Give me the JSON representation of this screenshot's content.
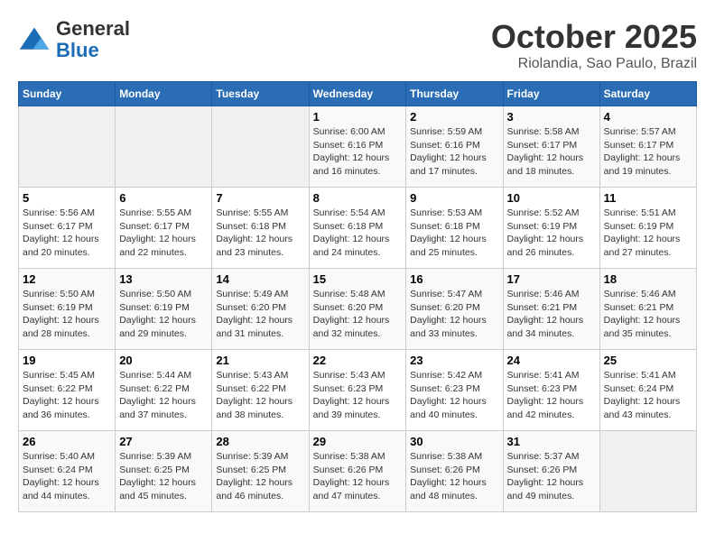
{
  "header": {
    "logo_line1": "General",
    "logo_line2": "Blue",
    "month": "October 2025",
    "location": "Riolandia, Sao Paulo, Brazil"
  },
  "weekdays": [
    "Sunday",
    "Monday",
    "Tuesday",
    "Wednesday",
    "Thursday",
    "Friday",
    "Saturday"
  ],
  "weeks": [
    [
      {
        "day": "",
        "info": ""
      },
      {
        "day": "",
        "info": ""
      },
      {
        "day": "",
        "info": ""
      },
      {
        "day": "1",
        "info": "Sunrise: 6:00 AM\nSunset: 6:16 PM\nDaylight: 12 hours\nand 16 minutes."
      },
      {
        "day": "2",
        "info": "Sunrise: 5:59 AM\nSunset: 6:16 PM\nDaylight: 12 hours\nand 17 minutes."
      },
      {
        "day": "3",
        "info": "Sunrise: 5:58 AM\nSunset: 6:17 PM\nDaylight: 12 hours\nand 18 minutes."
      },
      {
        "day": "4",
        "info": "Sunrise: 5:57 AM\nSunset: 6:17 PM\nDaylight: 12 hours\nand 19 minutes."
      }
    ],
    [
      {
        "day": "5",
        "info": "Sunrise: 5:56 AM\nSunset: 6:17 PM\nDaylight: 12 hours\nand 20 minutes."
      },
      {
        "day": "6",
        "info": "Sunrise: 5:55 AM\nSunset: 6:17 PM\nDaylight: 12 hours\nand 22 minutes."
      },
      {
        "day": "7",
        "info": "Sunrise: 5:55 AM\nSunset: 6:18 PM\nDaylight: 12 hours\nand 23 minutes."
      },
      {
        "day": "8",
        "info": "Sunrise: 5:54 AM\nSunset: 6:18 PM\nDaylight: 12 hours\nand 24 minutes."
      },
      {
        "day": "9",
        "info": "Sunrise: 5:53 AM\nSunset: 6:18 PM\nDaylight: 12 hours\nand 25 minutes."
      },
      {
        "day": "10",
        "info": "Sunrise: 5:52 AM\nSunset: 6:19 PM\nDaylight: 12 hours\nand 26 minutes."
      },
      {
        "day": "11",
        "info": "Sunrise: 5:51 AM\nSunset: 6:19 PM\nDaylight: 12 hours\nand 27 minutes."
      }
    ],
    [
      {
        "day": "12",
        "info": "Sunrise: 5:50 AM\nSunset: 6:19 PM\nDaylight: 12 hours\nand 28 minutes."
      },
      {
        "day": "13",
        "info": "Sunrise: 5:50 AM\nSunset: 6:19 PM\nDaylight: 12 hours\nand 29 minutes."
      },
      {
        "day": "14",
        "info": "Sunrise: 5:49 AM\nSunset: 6:20 PM\nDaylight: 12 hours\nand 31 minutes."
      },
      {
        "day": "15",
        "info": "Sunrise: 5:48 AM\nSunset: 6:20 PM\nDaylight: 12 hours\nand 32 minutes."
      },
      {
        "day": "16",
        "info": "Sunrise: 5:47 AM\nSunset: 6:20 PM\nDaylight: 12 hours\nand 33 minutes."
      },
      {
        "day": "17",
        "info": "Sunrise: 5:46 AM\nSunset: 6:21 PM\nDaylight: 12 hours\nand 34 minutes."
      },
      {
        "day": "18",
        "info": "Sunrise: 5:46 AM\nSunset: 6:21 PM\nDaylight: 12 hours\nand 35 minutes."
      }
    ],
    [
      {
        "day": "19",
        "info": "Sunrise: 5:45 AM\nSunset: 6:22 PM\nDaylight: 12 hours\nand 36 minutes."
      },
      {
        "day": "20",
        "info": "Sunrise: 5:44 AM\nSunset: 6:22 PM\nDaylight: 12 hours\nand 37 minutes."
      },
      {
        "day": "21",
        "info": "Sunrise: 5:43 AM\nSunset: 6:22 PM\nDaylight: 12 hours\nand 38 minutes."
      },
      {
        "day": "22",
        "info": "Sunrise: 5:43 AM\nSunset: 6:23 PM\nDaylight: 12 hours\nand 39 minutes."
      },
      {
        "day": "23",
        "info": "Sunrise: 5:42 AM\nSunset: 6:23 PM\nDaylight: 12 hours\nand 40 minutes."
      },
      {
        "day": "24",
        "info": "Sunrise: 5:41 AM\nSunset: 6:23 PM\nDaylight: 12 hours\nand 42 minutes."
      },
      {
        "day": "25",
        "info": "Sunrise: 5:41 AM\nSunset: 6:24 PM\nDaylight: 12 hours\nand 43 minutes."
      }
    ],
    [
      {
        "day": "26",
        "info": "Sunrise: 5:40 AM\nSunset: 6:24 PM\nDaylight: 12 hours\nand 44 minutes."
      },
      {
        "day": "27",
        "info": "Sunrise: 5:39 AM\nSunset: 6:25 PM\nDaylight: 12 hours\nand 45 minutes."
      },
      {
        "day": "28",
        "info": "Sunrise: 5:39 AM\nSunset: 6:25 PM\nDaylight: 12 hours\nand 46 minutes."
      },
      {
        "day": "29",
        "info": "Sunrise: 5:38 AM\nSunset: 6:26 PM\nDaylight: 12 hours\nand 47 minutes."
      },
      {
        "day": "30",
        "info": "Sunrise: 5:38 AM\nSunset: 6:26 PM\nDaylight: 12 hours\nand 48 minutes."
      },
      {
        "day": "31",
        "info": "Sunrise: 5:37 AM\nSunset: 6:26 PM\nDaylight: 12 hours\nand 49 minutes."
      },
      {
        "day": "",
        "info": ""
      }
    ]
  ]
}
